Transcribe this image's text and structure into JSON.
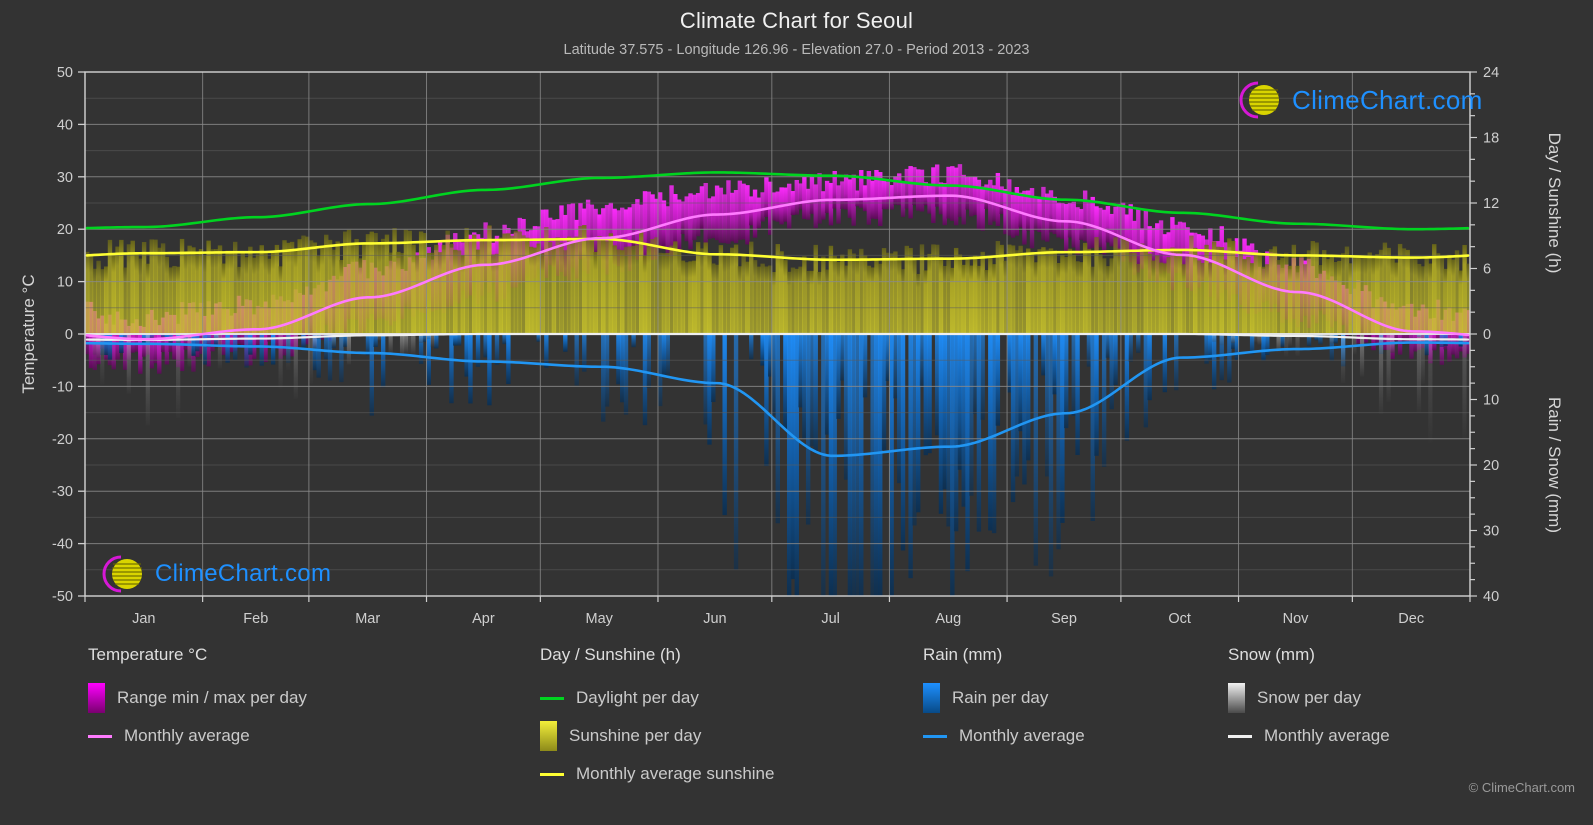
{
  "header": {
    "title": "Climate Chart for Seoul",
    "subtitle": "Latitude 37.575 - Longitude 126.96 - Elevation 27.0 - Period 2013 - 2023"
  },
  "watermark": {
    "text": "ClimeChart.com",
    "ring_color": "#d618d6",
    "ball_color": "#d9d400",
    "text_color": "#1e90ff"
  },
  "footer": {
    "copyright": "© ClimeChart.com"
  },
  "axes": {
    "left": {
      "title": "Temperature °C",
      "ticks": [
        "50",
        "40",
        "30",
        "20",
        "10",
        "0",
        "-10",
        "-20",
        "-30",
        "-40",
        "-50"
      ],
      "min": -50,
      "max": 50
    },
    "right_top": {
      "title": "Day / Sunshine (h)",
      "ticks": [
        "24",
        "18",
        "12",
        "6",
        "0"
      ],
      "min": 0,
      "max": 24
    },
    "right_bottom": {
      "title": "Rain / Snow (mm)",
      "ticks": [
        "0",
        "10",
        "20",
        "30",
        "40"
      ],
      "min": 0,
      "max": 40
    },
    "x": {
      "ticks": [
        "Jan",
        "Feb",
        "Mar",
        "Apr",
        "May",
        "Jun",
        "Jul",
        "Aug",
        "Sep",
        "Oct",
        "Nov",
        "Dec"
      ]
    }
  },
  "legend": {
    "groups": [
      {
        "title": "Temperature °C",
        "items": [
          {
            "label": "Range min / max per day",
            "type": "gradient",
            "color": "#ff00ff",
            "color2": "#7a0070"
          },
          {
            "label": "Monthly average",
            "type": "line",
            "color": "#ff7bff"
          }
        ]
      },
      {
        "title": "Day / Sunshine (h)",
        "items": [
          {
            "label": "Daylight per day",
            "type": "line",
            "color": "#00d420"
          },
          {
            "label": "Sunshine per day",
            "type": "gradient",
            "color": "#f3ef3a",
            "color2": "#8d8a1a"
          },
          {
            "label": "Monthly average sunshine",
            "type": "line",
            "color": "#ffff33"
          }
        ]
      },
      {
        "title": "Rain (mm)",
        "items": [
          {
            "label": "Rain per day",
            "type": "gradient",
            "color": "#1e90ff",
            "color2": "#084a87"
          },
          {
            "label": "Monthly average",
            "type": "line",
            "color": "#2196f3"
          }
        ]
      },
      {
        "title": "Snow (mm)",
        "items": [
          {
            "label": "Snow per day",
            "type": "gradient",
            "color": "#f2f2f2",
            "color2": "#4a4a4a"
          },
          {
            "label": "Monthly average",
            "type": "line",
            "color": "#f0f0f0"
          }
        ]
      }
    ]
  },
  "chart_data": {
    "type": "line",
    "title": "Climate Chart for Seoul",
    "subtitle": "Latitude 37.575 - Longitude 126.96 - Elevation 27.0 - Period 2013 - 2023",
    "xlabel": "",
    "ylabel": "Temperature °C",
    "ylim": [
      -50,
      50
    ],
    "y2lim_day": [
      0,
      24
    ],
    "y2lim_precip": [
      0,
      40
    ],
    "grid": true,
    "legend_position": "below",
    "categories": [
      "Jan",
      "Feb",
      "Mar",
      "Apr",
      "May",
      "Jun",
      "Jul",
      "Aug",
      "Sep",
      "Oct",
      "Nov",
      "Dec"
    ],
    "series": [
      {
        "name": "Daylight per day",
        "unit": "h",
        "axis": "right_top",
        "color": "#00d420",
        "values": [
          9.8,
          10.7,
          11.9,
          13.2,
          14.3,
          14.8,
          14.5,
          13.6,
          12.3,
          11.1,
          10.1,
          9.6
        ]
      },
      {
        "name": "Monthly average sunshine",
        "unit": "h",
        "axis": "right_top",
        "color": "#ffff33",
        "values": [
          7.4,
          7.5,
          8.3,
          8.6,
          8.7,
          7.3,
          6.8,
          6.9,
          7.5,
          7.7,
          7.2,
          7.0
        ]
      },
      {
        "name": "Monthly average temperature",
        "unit": "°C",
        "axis": "left",
        "color": "#ff7bff",
        "values": [
          -1.0,
          0.9,
          7.0,
          13.2,
          18.3,
          22.8,
          25.6,
          26.4,
          21.5,
          15.1,
          8.0,
          0.5
        ]
      },
      {
        "name": "Rain monthly average",
        "unit": "mm",
        "axis": "right_bottom",
        "color": "#2196f3",
        "values": [
          1.5,
          1.9,
          2.9,
          4.2,
          5.0,
          7.5,
          18.6,
          17.2,
          12.1,
          3.6,
          2.3,
          1.3
        ]
      },
      {
        "name": "Snow monthly average",
        "unit": "mm",
        "axis": "right_bottom",
        "color": "#f0f0f0",
        "values": [
          0.9,
          0.7,
          0.2,
          0.0,
          0.0,
          0.0,
          0.0,
          0.0,
          0.0,
          0.0,
          0.3,
          0.8
        ]
      }
    ],
    "daily_ranges": {
      "name": "Range min / max per day",
      "unit": "°C",
      "axis": "left",
      "color": "#ff00ff",
      "tmin": [
        -5.5,
        -3.6,
        2.2,
        8.2,
        13.6,
        19.0,
        22.6,
        23.2,
        17.6,
        10.4,
        3.4,
        -3.2
      ],
      "tmax": [
        3.2,
        5.6,
        12.1,
        19.0,
        24.1,
        27.2,
        29.1,
        30.2,
        26.0,
        20.4,
        12.6,
        4.6
      ]
    },
    "sunshine_daily": {
      "name": "Sunshine per day",
      "unit": "h",
      "axis": "right_top",
      "color": "#d9d400",
      "values": [
        7.4,
        7.5,
        8.3,
        8.6,
        8.7,
        7.3,
        6.8,
        6.9,
        7.5,
        7.7,
        7.2,
        7.0
      ]
    },
    "rain_daily": {
      "name": "Rain per day",
      "unit": "mm",
      "axis": "right_bottom",
      "color": "#1e90ff",
      "peak_month": "Jul",
      "peak_value": 40
    },
    "snow_daily": {
      "name": "Snow per day",
      "unit": "mm",
      "axis": "right_bottom",
      "color": "#e8e8e8",
      "months_with_snow": [
        "Jan",
        "Feb",
        "Mar",
        "Nov",
        "Dec"
      ]
    }
  }
}
